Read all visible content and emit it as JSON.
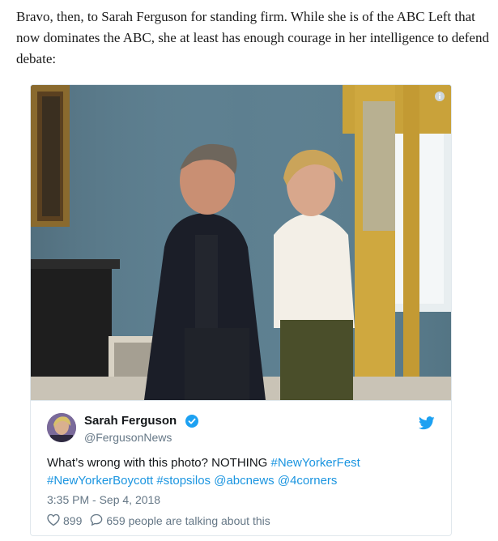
{
  "article": {
    "paragraph": "Bravo, then, to Sarah Ferguson for standing firm. While she is of the ABC Left that now dominates the ABC, she at least has enough courage in her intelligence to defend debate:"
  },
  "tweet": {
    "author_name": "Sarah Ferguson",
    "author_handle": "@FergusonNews",
    "text_prefix": "What’s wrong with this photo? NOTHING ",
    "links": [
      "#NewYorkerFest",
      "#NewYorkerBoycott",
      "#stopsilos",
      "@abcnews",
      "@4corners"
    ],
    "timestamp": "3:35 PM - Sep 4, 2018",
    "like_count": "899",
    "reply_text": "659 people are talking about this",
    "colors": {
      "link": "#1b95e0",
      "muted": "#657786",
      "verified": "#1da1f2"
    },
    "icons": [
      "info-icon",
      "verified-icon",
      "twitter-bird-icon",
      "heart-icon",
      "speech-bubble-icon"
    ]
  }
}
